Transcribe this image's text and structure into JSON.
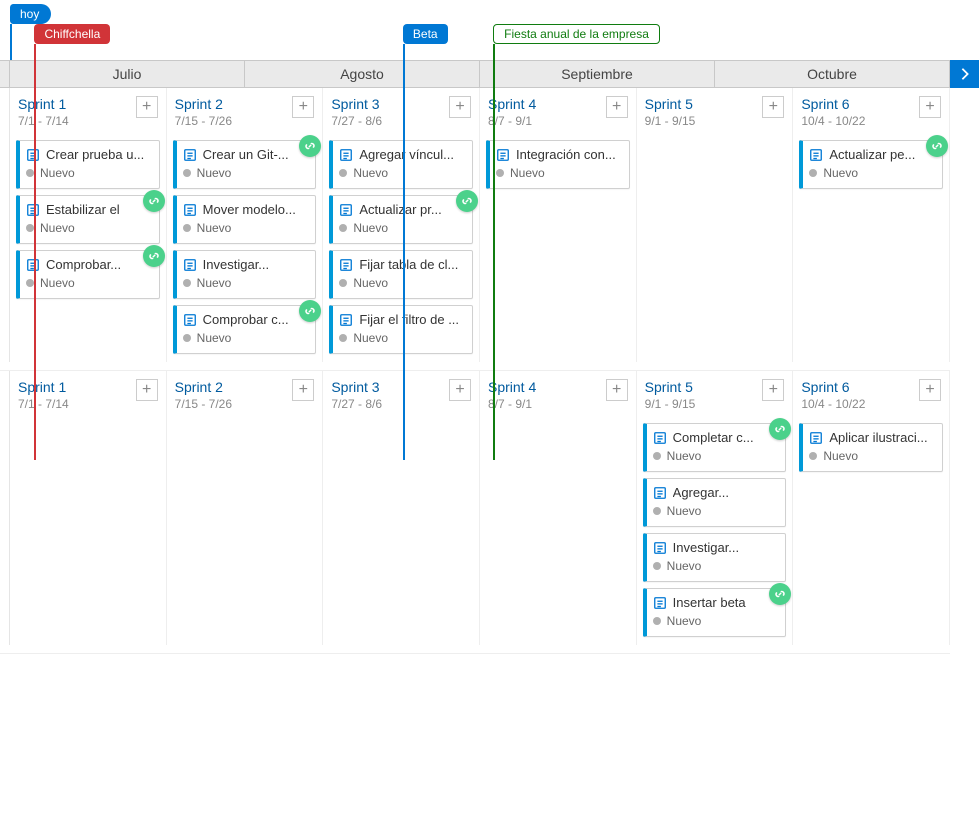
{
  "timeline": {
    "today_label": "hoy",
    "markers": [
      {
        "id": "chiffchella",
        "label": "Chiffchella",
        "pct": 2.6
      },
      {
        "id": "beta",
        "label": "Beta",
        "pct": 41.8
      },
      {
        "id": "fiesta",
        "label": "Fiesta anual de la empresa",
        "pct": 51.4
      }
    ],
    "today_pct": 0.0
  },
  "months": [
    "Julio",
    "Agosto",
    "Septiembre",
    "Octubre"
  ],
  "status_label": "Nuevo",
  "lanes": [
    {
      "sprints": [
        {
          "title": "Sprint 1",
          "dates": "7/1 - 7/14",
          "cards": [
            {
              "title": "Crear prueba u...",
              "linked": false
            },
            {
              "title": "Estabilizar el",
              "linked": true
            },
            {
              "title": "Comprobar...",
              "linked": true
            }
          ]
        },
        {
          "title": "Sprint 2",
          "dates": "7/15 - 7/26",
          "cards": [
            {
              "title": "Crear un Git-...",
              "linked": true
            },
            {
              "title": "Mover modelo...",
              "linked": false
            },
            {
              "title": "Investigar...",
              "linked": false
            },
            {
              "title": "Comprobar c...",
              "linked": true
            }
          ]
        },
        {
          "title": "Sprint 3",
          "dates": "7/27 - 8/6",
          "cards": [
            {
              "title": "Agregar víncul...",
              "linked": false
            },
            {
              "title": "Actualizar pr...",
              "linked": true
            },
            {
              "title": "Fijar tabla de cl...",
              "linked": false
            },
            {
              "title": "Fijar el filtro de ...",
              "linked": false
            }
          ]
        },
        {
          "title": "Sprint 4",
          "dates": "8/7 - 9/1",
          "cards": [
            {
              "title": "Integración con...",
              "linked": false
            }
          ]
        },
        {
          "title": "Sprint 5",
          "dates": "9/1 - 9/15",
          "cards": []
        },
        {
          "title": "Sprint 6",
          "dates": "10/4 - 10/22",
          "cards": [
            {
              "title": "Actualizar pe...",
              "linked": true
            }
          ]
        }
      ]
    },
    {
      "sprints": [
        {
          "title": "Sprint 1",
          "dates": "7/1 - 7/14",
          "cards": []
        },
        {
          "title": "Sprint 2",
          "dates": "7/15 - 7/26",
          "cards": []
        },
        {
          "title": "Sprint 3",
          "dates": "7/27 - 8/6",
          "cards": []
        },
        {
          "title": "Sprint 4",
          "dates": "8/7 - 9/1",
          "cards": []
        },
        {
          "title": "Sprint 5",
          "dates": "9/1 - 9/15",
          "cards": [
            {
              "title": "Completar c...",
              "linked": true
            },
            {
              "title": "Agregar...",
              "linked": false
            },
            {
              "title": "Investigar...",
              "linked": false
            },
            {
              "title": "Insertar beta",
              "linked": true
            }
          ]
        },
        {
          "title": "Sprint 6",
          "dates": "10/4 - 10/22",
          "cards": [
            {
              "title": "Aplicar ilustraci...",
              "linked": false
            }
          ]
        }
      ]
    }
  ]
}
